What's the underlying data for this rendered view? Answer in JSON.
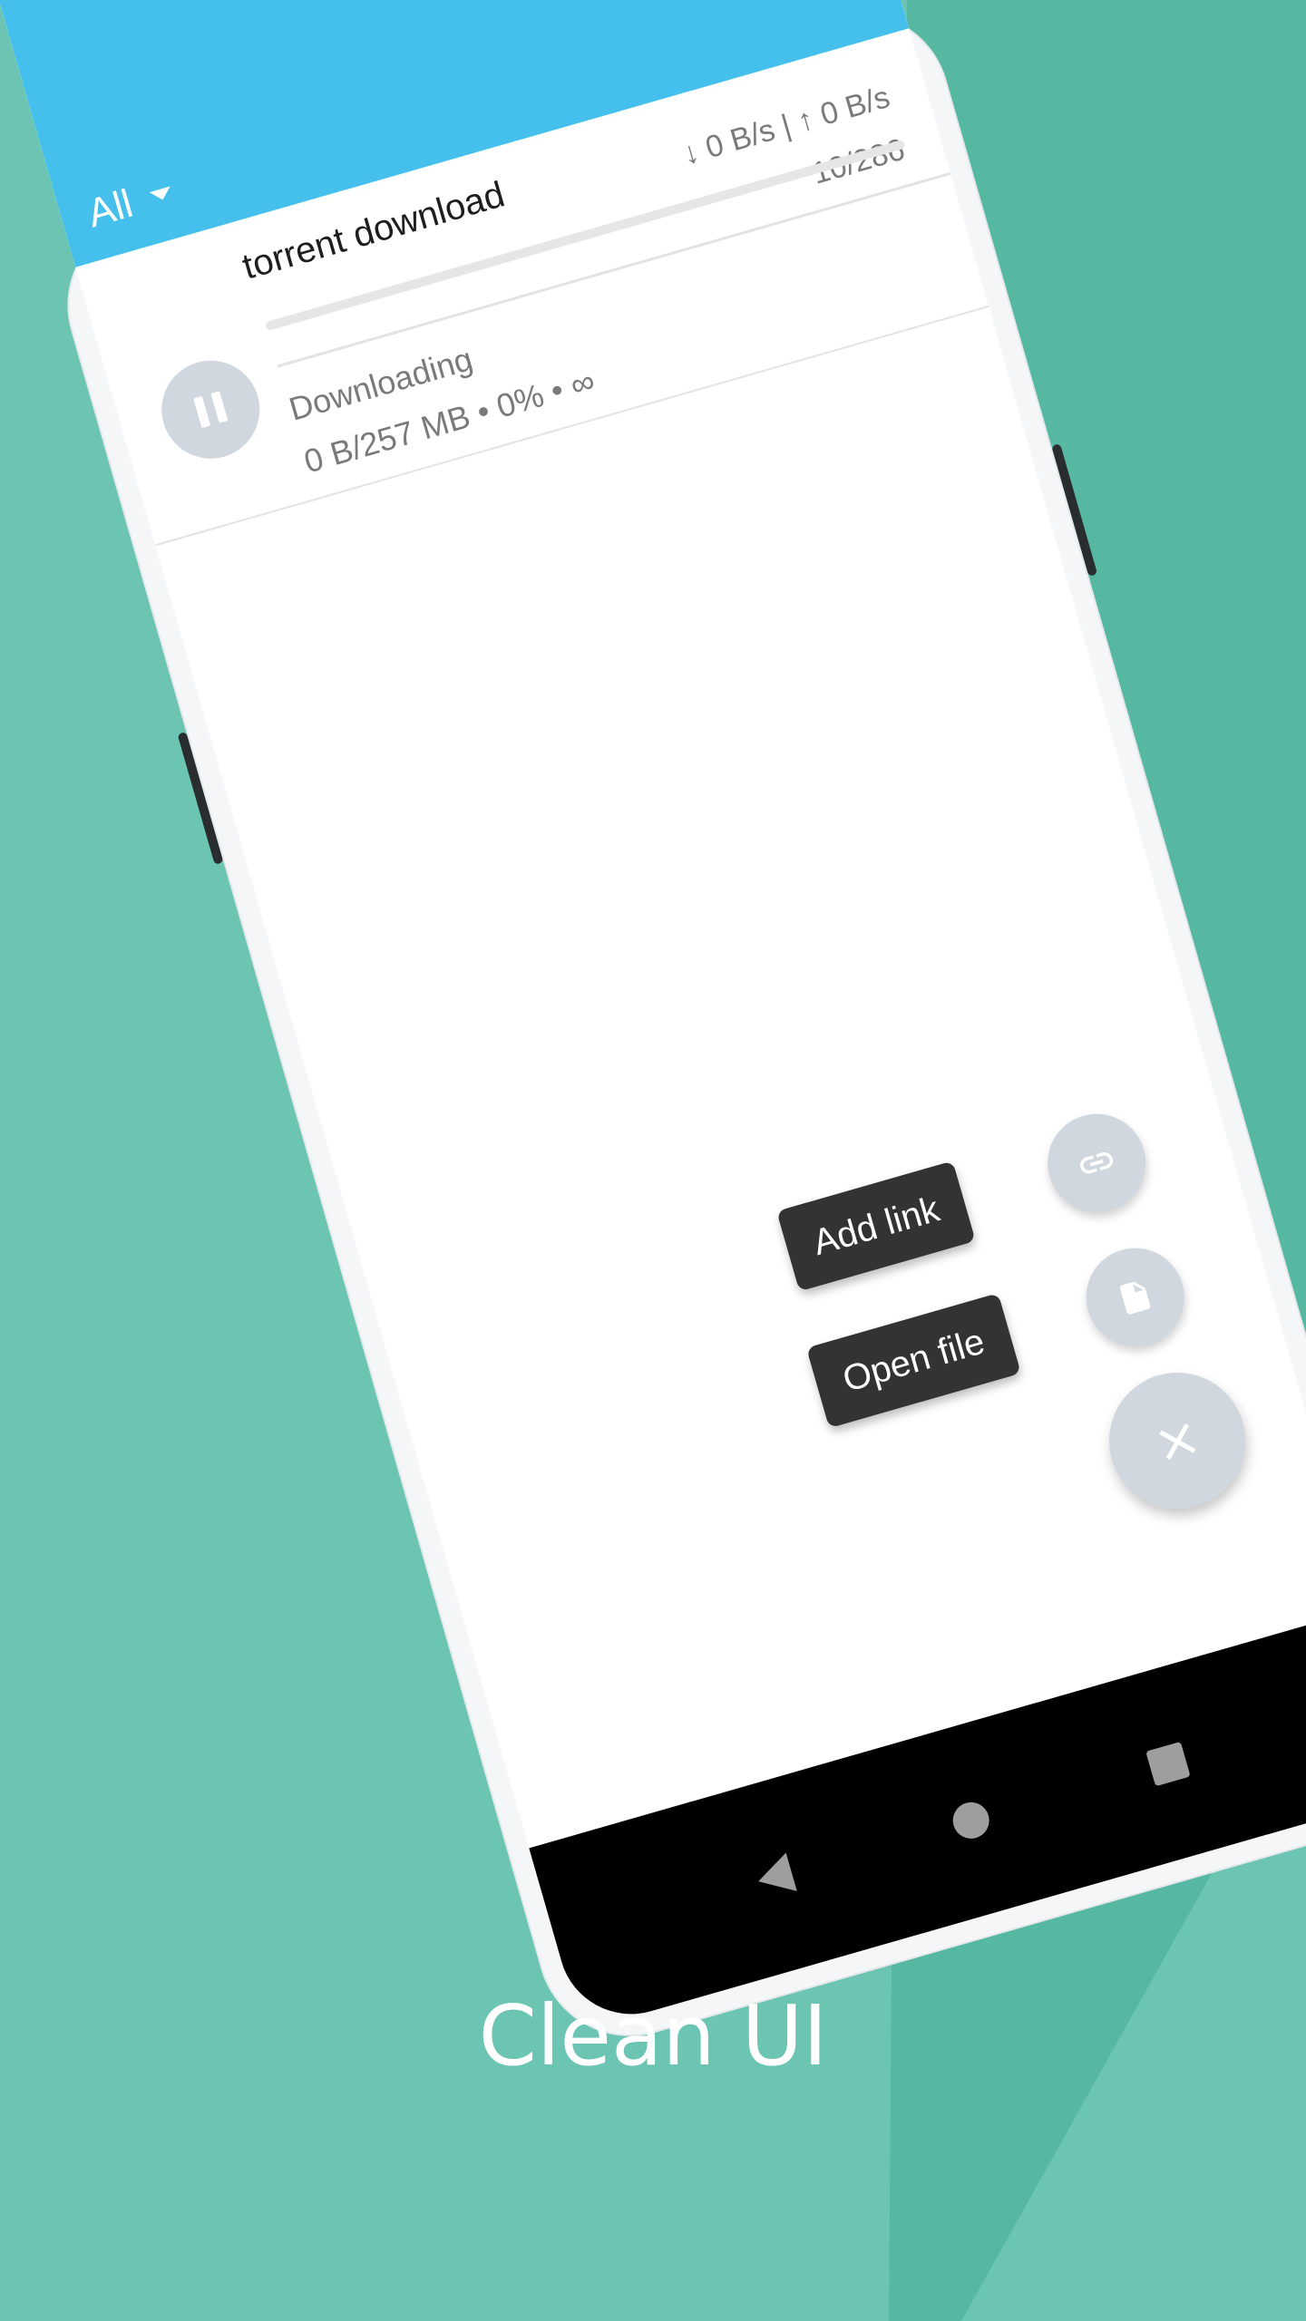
{
  "appbar": {
    "filter_label": "All"
  },
  "torrent": {
    "title": "torrent download",
    "speeds": "↓ 0 B/s | ↑ 0 B/s",
    "peers": "10/286",
    "status": "Downloading",
    "stats": "0 B/257 MB • 0% • ∞",
    "progress": 0
  },
  "fab": {
    "add_link_label": "Add link",
    "open_file_label": "Open file",
    "main_icon": "close-icon",
    "link_icon": "link-icon",
    "file_icon": "file-icon"
  },
  "nav": {
    "back": "back-icon",
    "home": "home-icon",
    "recent": "recent-apps-icon"
  },
  "caption": "Clean UI",
  "colors": {
    "background": "#6cc4b2",
    "background_accent": "#56b8a2",
    "appbar": "#45c0ec",
    "fab": "#d0d7de",
    "chip": "#333333"
  }
}
